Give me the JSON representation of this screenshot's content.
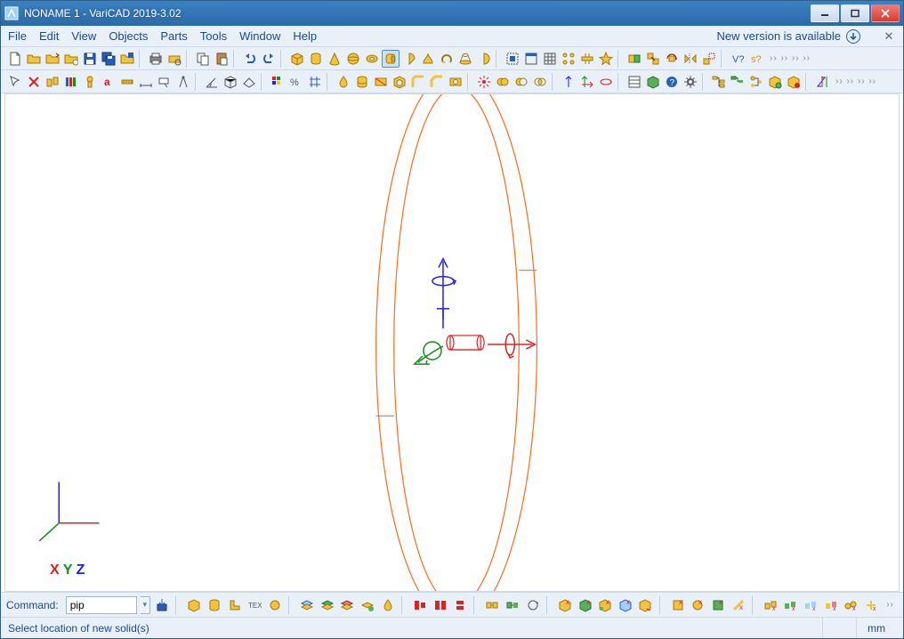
{
  "titlebar": {
    "title": "NONAME 1 - VariCAD 2019-3.02"
  },
  "menu": {
    "file": "File",
    "edit": "Edit",
    "view": "View",
    "objects": "Objects",
    "parts": "Parts",
    "tools": "Tools",
    "window": "Window",
    "help": "Help",
    "new_version": "New version is available"
  },
  "command": {
    "label": "Command:",
    "value": "pip"
  },
  "status": {
    "text": "Select location of new solid(s)",
    "units": "mm"
  },
  "axis": {
    "x": "X",
    "y": "Y",
    "z": "Z"
  },
  "colors": {
    "accent": "#1a4a8b",
    "bg": "#e9f0f8",
    "x": "#e02020",
    "y": "#109018",
    "z": "#2020e0",
    "model": "#ff6a1a"
  }
}
